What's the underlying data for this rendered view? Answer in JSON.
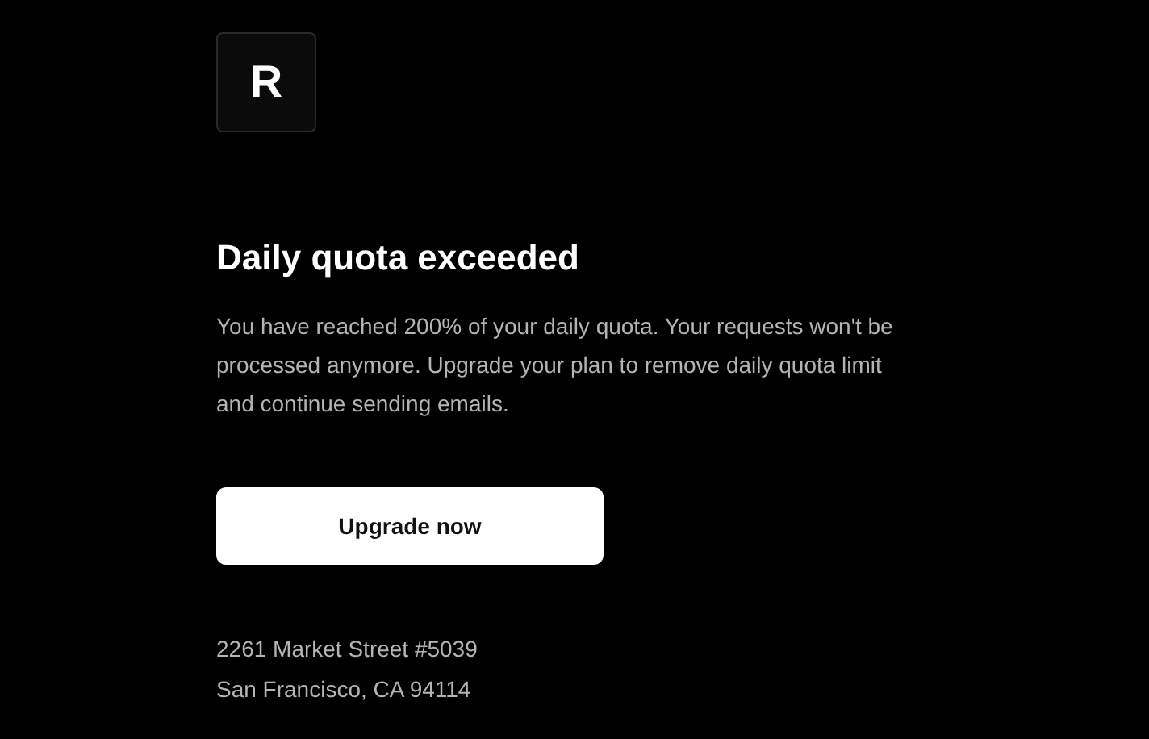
{
  "logo": {
    "letter": "R"
  },
  "heading": "Daily quota exceeded",
  "message": "You have reached 200% of your daily quota. Your requests won't be processed anymore. Upgrade your plan to remove daily quota limit and continue sending emails.",
  "button": {
    "label": "Upgrade now"
  },
  "address": [
    "2261 Market Street #5039",
    "San Francisco, CA 94114"
  ]
}
